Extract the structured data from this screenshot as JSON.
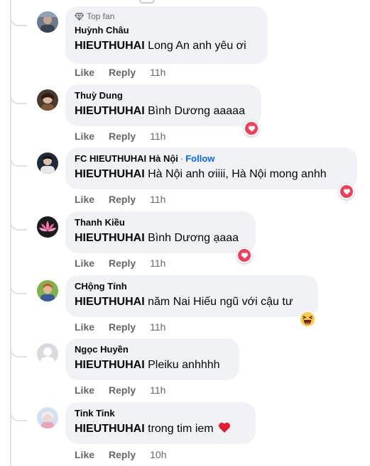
{
  "labels": {
    "like": "Like",
    "reply": "Reply",
    "follow": "Follow",
    "dot": "·"
  },
  "colors": {
    "bubble": "#f0f2f5",
    "love": "#f33e58",
    "link": "#0866ff",
    "meta": "#65676b"
  },
  "comments": [
    {
      "name": "Huỳnh Châu",
      "badge": "Top fan",
      "mention": "HIEUTHUHAI",
      "text": "Long An anh yêu ơi",
      "time": "11h"
    },
    {
      "name": "Thuỳ Dung",
      "mention": "HIEUTHUHAI",
      "text": "Bình Dương aaaaa",
      "time": "11h",
      "reaction": "love-icon"
    },
    {
      "name": "FC HIEUTHUHAI Hà Nội",
      "mention": "HIEUTHUHAI",
      "text": "Hà Nội anh ơiiii, Hà Nội mong anhh",
      "time": "11h",
      "reaction": "love-icon"
    },
    {
      "name": "Thanh Kiều",
      "mention": "HIEUTHUHAI",
      "text": "Bình Dương ạaaa",
      "time": "11h",
      "reaction": "love-icon"
    },
    {
      "name": "CHộng Tính",
      "mention": "HIEUTHUHAI",
      "text": "năm Nai Hiếu ngũ với cậu tư",
      "time": "11h",
      "reaction": "haha-icon"
    },
    {
      "name": "Ngọc Huyền",
      "mention": "HIEUTHUHAI",
      "text": "Pleiku anhhhh",
      "time": "11h"
    },
    {
      "name": "Tink Tink",
      "mention": "HIEUTHUHAI",
      "text": "trong tim iem",
      "time": "10h",
      "emoji": "red-heart-emoji"
    }
  ]
}
